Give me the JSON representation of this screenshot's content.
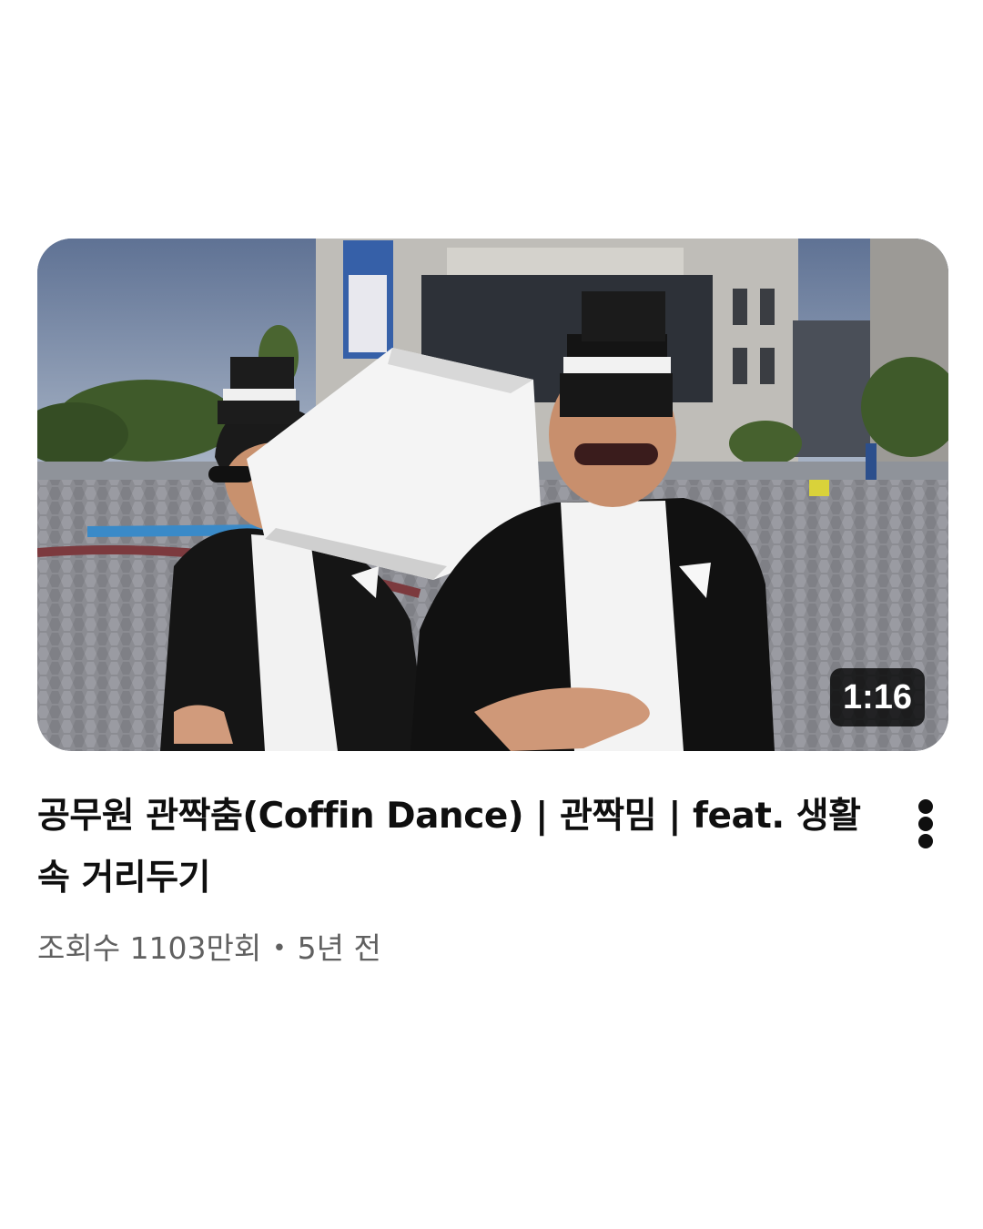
{
  "video": {
    "duration": "1:16",
    "title": "공무원 관짝춤(Coffin Dance) | 관짝밈 | feat. 생활 속 거리두기",
    "views": "조회수 1103만회",
    "separator": "•",
    "age": "5년 전",
    "more_icon": "more-vertical-icon"
  }
}
